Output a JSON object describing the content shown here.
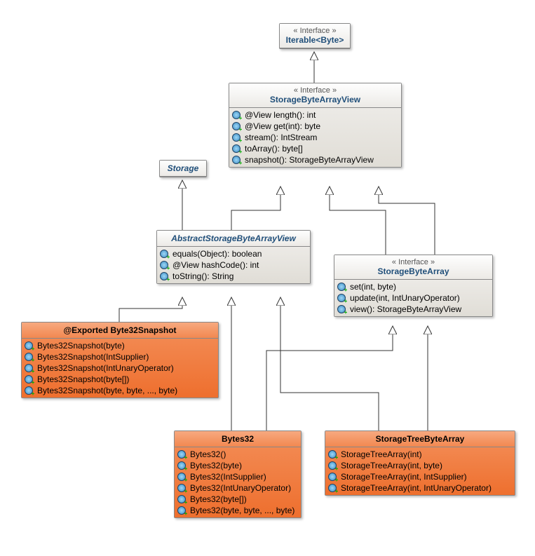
{
  "iterable": {
    "stereo": "« Interface »",
    "name": "Iterable<Byte>"
  },
  "storageByteArrayView": {
    "stereo": "« Interface »",
    "name": "StorageByteArrayView",
    "members": [
      "@View length(): int",
      "@View get(int): byte",
      "stream(): IntStream",
      "toArray(): byte[]",
      "snapshot(): StorageByteArrayView"
    ]
  },
  "storage": {
    "name": "Storage"
  },
  "abstractStorageByteArrayView": {
    "name": "AbstractStorageByteArrayView",
    "members": [
      "equals(Object): boolean",
      "@View hashCode(): int",
      "toString(): String"
    ]
  },
  "storageByteArray": {
    "stereo": "« Interface »",
    "name": "StorageByteArray",
    "members": [
      "set(int, byte)",
      "update(int, IntUnaryOperator)",
      "view(): StorageByteArrayView"
    ]
  },
  "byte32Snapshot": {
    "name": "@Exported Byte32Snapshot",
    "members": [
      "Bytes32Snapshot(byte)",
      "Bytes32Snapshot(IntSupplier)",
      "Bytes32Snapshot(IntUnaryOperator)",
      "Bytes32Snapshot(byte[])",
      "Bytes32Snapshot(byte, byte, ..., byte)"
    ]
  },
  "bytes32": {
    "name": "Bytes32",
    "members": [
      "Bytes32()",
      "Bytes32(byte)",
      "Bytes32(IntSupplier)",
      "Bytes32(IntUnaryOperator)",
      "Bytes32(byte[])",
      "Bytes32(byte, byte, ..., byte)"
    ]
  },
  "storageTreeByteArray": {
    "name": "StorageTreeByteArray",
    "members": [
      "StorageTreeArray(int)",
      "StorageTreeArray(int, byte)",
      "StorageTreeArray(int, IntSupplier)",
      "StorageTreeArray(int, IntUnaryOperator)"
    ]
  },
  "chart_data": {
    "type": "uml-class-diagram",
    "classes": [
      {
        "name": "Iterable<Byte>",
        "kind": "interface"
      },
      {
        "name": "StorageByteArrayView",
        "kind": "interface",
        "methods": [
          "@View length(): int",
          "@View get(int): byte",
          "stream(): IntStream",
          "toArray(): byte[]",
          "snapshot(): StorageByteArrayView"
        ]
      },
      {
        "name": "Storage",
        "kind": "class",
        "abstract": true
      },
      {
        "name": "AbstractStorageByteArrayView",
        "kind": "class",
        "abstract": true,
        "methods": [
          "equals(Object): boolean",
          "@View hashCode(): int",
          "toString(): String"
        ]
      },
      {
        "name": "StorageByteArray",
        "kind": "interface",
        "methods": [
          "set(int, byte)",
          "update(int, IntUnaryOperator)",
          "view(): StorageByteArrayView"
        ]
      },
      {
        "name": "@Exported Byte32Snapshot",
        "kind": "class",
        "methods": [
          "Bytes32Snapshot(byte)",
          "Bytes32Snapshot(IntSupplier)",
          "Bytes32Snapshot(IntUnaryOperator)",
          "Bytes32Snapshot(byte[])",
          "Bytes32Snapshot(byte, byte, ..., byte)"
        ]
      },
      {
        "name": "Bytes32",
        "kind": "class",
        "methods": [
          "Bytes32()",
          "Bytes32(byte)",
          "Bytes32(IntSupplier)",
          "Bytes32(IntUnaryOperator)",
          "Bytes32(byte[])",
          "Bytes32(byte, byte, ..., byte)"
        ]
      },
      {
        "name": "StorageTreeByteArray",
        "kind": "class",
        "methods": [
          "StorageTreeArray(int)",
          "StorageTreeArray(int, byte)",
          "StorageTreeArray(int, IntSupplier)",
          "StorageTreeArray(int, IntUnaryOperator)"
        ]
      }
    ],
    "relations": [
      {
        "from": "StorageByteArrayView",
        "to": "Iterable<Byte>",
        "type": "realization"
      },
      {
        "from": "AbstractStorageByteArrayView",
        "to": "Storage",
        "type": "generalization"
      },
      {
        "from": "AbstractStorageByteArrayView",
        "to": "StorageByteArrayView",
        "type": "realization"
      },
      {
        "from": "StorageByteArray",
        "to": "StorageByteArrayView",
        "type": "realization"
      },
      {
        "from": "Byte32Snapshot",
        "to": "AbstractStorageByteArrayView",
        "type": "generalization"
      },
      {
        "from": "Bytes32",
        "to": "AbstractStorageByteArrayView",
        "type": "generalization"
      },
      {
        "from": "Bytes32",
        "to": "StorageByteArray",
        "type": "realization"
      },
      {
        "from": "StorageTreeByteArray",
        "to": "AbstractStorageByteArrayView",
        "type": "generalization"
      },
      {
        "from": "StorageTreeByteArray",
        "to": "StorageByteArray",
        "type": "realization"
      }
    ]
  }
}
